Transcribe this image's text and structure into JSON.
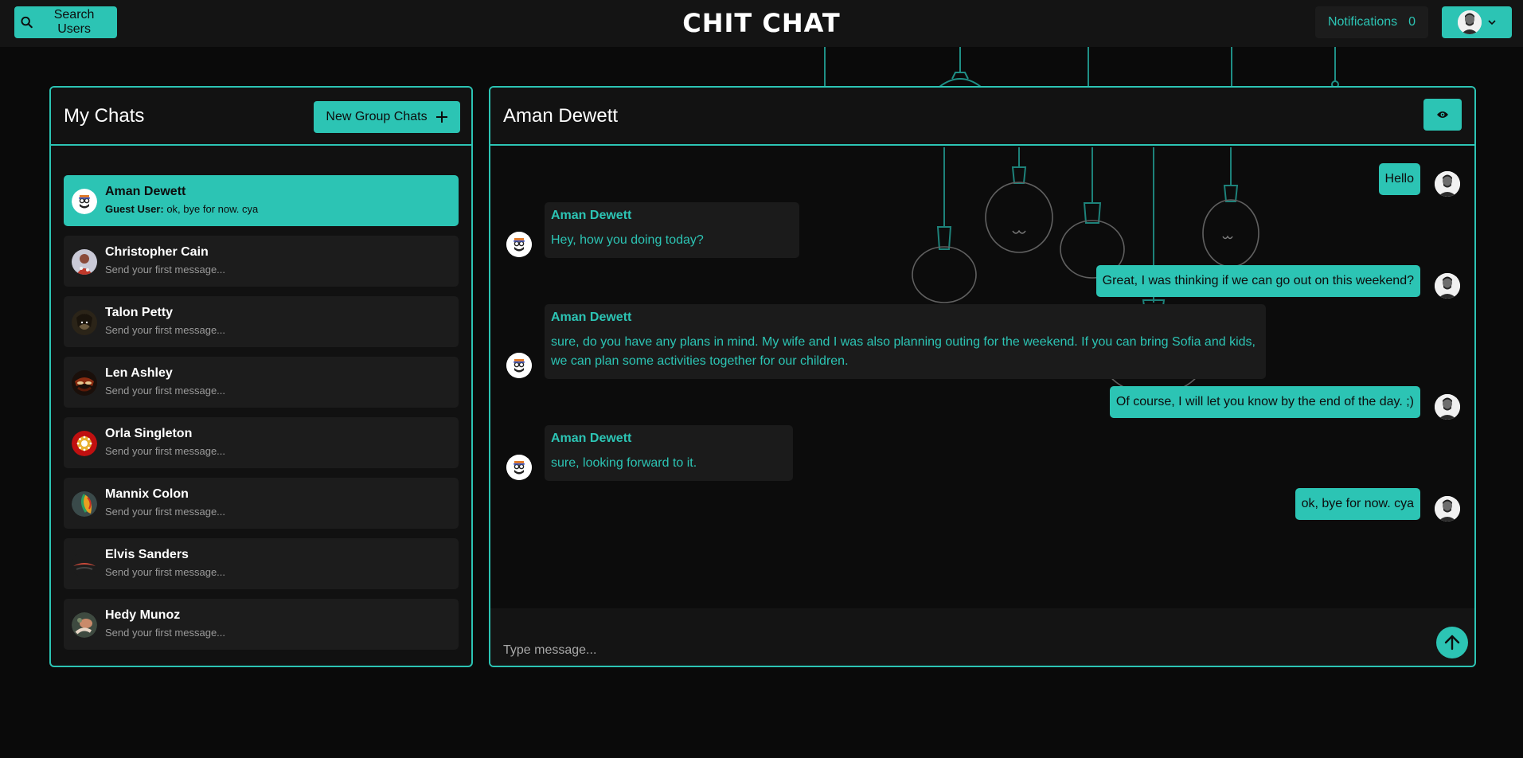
{
  "topbar": {
    "search_label": "Search Users",
    "app_title": "CHIT CHAT",
    "notifications_label": "Notifications",
    "notifications_count": "0"
  },
  "colors": {
    "accent": "#2cc4b4",
    "background": "#0a0a0a",
    "panel": "#111111",
    "item": "#1c1c1c"
  },
  "chats_panel": {
    "title": "My Chats",
    "new_group_label": "New Group Chats",
    "items": [
      {
        "name": "Aman Dewett",
        "preview_prefix": "Guest User:",
        "preview": "ok, bye for now. cya",
        "active": true,
        "icon": "cartoon-avatar"
      },
      {
        "name": "Christopher Cain",
        "preview": "Send your first message...",
        "icon": "photo-avatar"
      },
      {
        "name": "Talon Petty",
        "preview": "Send your first message...",
        "icon": "photo-avatar"
      },
      {
        "name": "Len Ashley",
        "preview": "Send your first message...",
        "icon": "photo-avatar"
      },
      {
        "name": "Orla Singleton",
        "preview": "Send your first message...",
        "icon": "photo-avatar"
      },
      {
        "name": "Mannix Colon",
        "preview": "Send your first message...",
        "icon": "photo-avatar"
      },
      {
        "name": "Elvis Sanders",
        "preview": "Send your first message...",
        "icon": "photo-avatar"
      },
      {
        "name": "Hedy Munoz",
        "preview": "Send your first message...",
        "icon": "photo-avatar"
      }
    ]
  },
  "chat": {
    "title": "Aman Dewett",
    "messages": [
      {
        "from": "me",
        "text": "Hello"
      },
      {
        "from": "them",
        "sender": "Aman Dewett",
        "text": "Hey, how you doing today?"
      },
      {
        "from": "me",
        "text": "Great, I was thinking if we can go out on this weekend?"
      },
      {
        "from": "them",
        "sender": "Aman Dewett",
        "text_line1": "sure, do you have any plans in mind. My wife and I was also planning outing for the weekend. If you can bring Sofia and kids,",
        "text_line2": "we can plan some activities together for our children."
      },
      {
        "from": "me",
        "text": "Of course, I will let you know by the end of the day. ;)"
      },
      {
        "from": "them",
        "sender": "Aman Dewett",
        "text": "sure, looking forward to it."
      },
      {
        "from": "me",
        "text": "ok, bye for now. cya"
      }
    ],
    "input_placeholder": "Type message..."
  }
}
